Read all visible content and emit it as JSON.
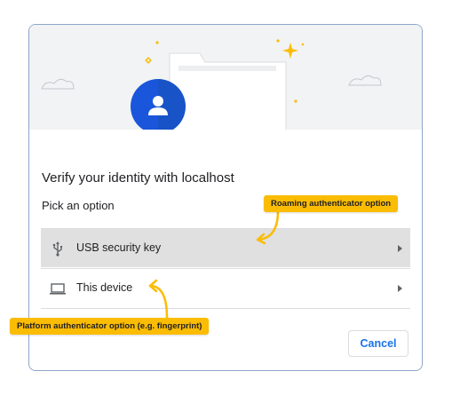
{
  "dialog": {
    "title": "Verify your identity with localhost",
    "subtitle": "Pick an option",
    "options": [
      {
        "label": "USB security key",
        "icon": "usb-icon",
        "highlighted": true
      },
      {
        "label": "This device",
        "icon": "laptop-icon",
        "highlighted": false
      }
    ],
    "cancel_label": "Cancel"
  },
  "callouts": {
    "roaming": "Roaming authenticator option",
    "platform": "Platform authenticator option (e.g. fingerprint)"
  },
  "colors": {
    "accent": "#1a73e8",
    "avatar": "#1a56db",
    "callout": "#fbbc04",
    "hero_bg": "#f1f3f4"
  }
}
